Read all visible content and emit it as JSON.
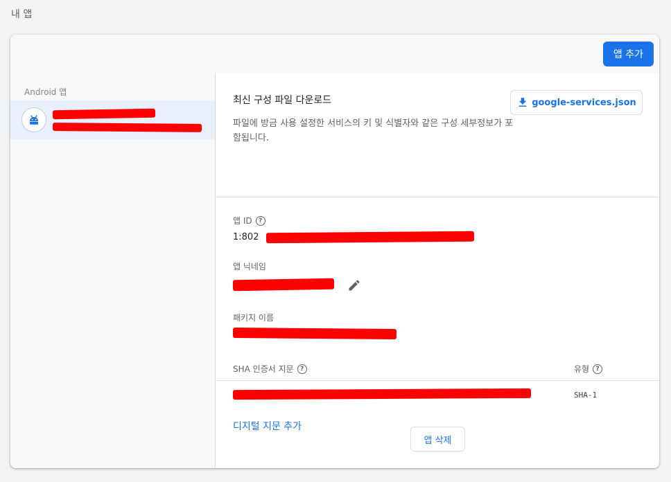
{
  "page": {
    "section_title": "내 앱"
  },
  "toolbar": {
    "add_app_label": "앱 추가"
  },
  "sidebar": {
    "platform_label": "Android 앱",
    "items": [
      {
        "icon": "android-icon"
      }
    ]
  },
  "config": {
    "title": "최신 구성 파일 다운로드",
    "description": "파일에 방금 사용 설정한 서비스의 키 및 식별자와 같은 구성 세부정보가 포함됩니다.",
    "download_label": "google-services.json"
  },
  "details": {
    "app_id_label": "앱 ID",
    "app_id_value": "1:802",
    "nickname_label": "앱 닉네임",
    "package_label": "패키지 이름",
    "sha_label": "SHA 인증서 지문",
    "type_label": "유형",
    "sha_type": "SHA-1",
    "add_fingerprint_label": "디지털 지문 추가"
  },
  "actions": {
    "delete_label": "앱 삭제"
  },
  "colors": {
    "accent": "#1a73e8",
    "redaction": "#ff0000",
    "selected_bg": "#e8f0fe"
  }
}
